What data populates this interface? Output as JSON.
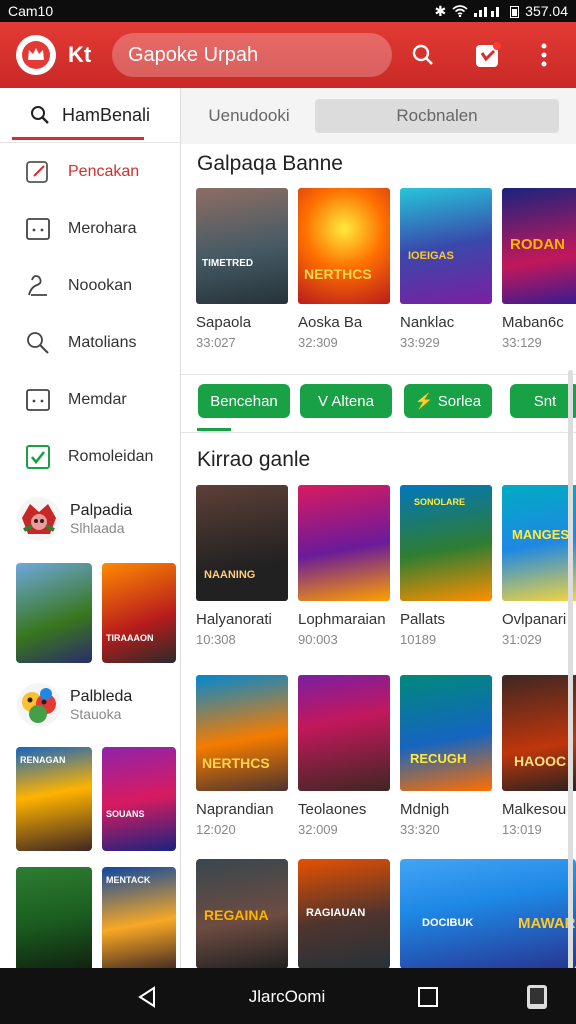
{
  "status_bar": {
    "left": "Cam10",
    "time": "357.04"
  },
  "app_bar": {
    "brand": "Kt",
    "search_placeholder": "Gapoke Urpah",
    "notification_badge": "1",
    "accent": "#d32f2f"
  },
  "sidebar": {
    "header": "HamBenali",
    "items": [
      {
        "label": "Pencakan",
        "icon": "edit-icon",
        "active": true
      },
      {
        "label": "Merohara",
        "icon": "face-icon"
      },
      {
        "label": "Noookan",
        "icon": "person-icon"
      },
      {
        "label": "Matolians",
        "icon": "search-icon"
      },
      {
        "label": "Memdar",
        "icon": "face-icon"
      },
      {
        "label": "Romoleidan",
        "icon": "checkbox-icon"
      }
    ],
    "promos": [
      {
        "title": "Palpadia",
        "subtitle": "Slhlaada"
      },
      {
        "title": "Palbleda",
        "subtitle": "Stauoka"
      }
    ]
  },
  "tabs": [
    {
      "label": "Uenudooki"
    },
    {
      "label": "Rocbnalen"
    }
  ],
  "sections": [
    {
      "title": "Galpaqa Banne",
      "cards": [
        {
          "name": "Sapaola",
          "meta": "33:027"
        },
        {
          "name": "Aoska Ba",
          "meta": "32:309"
        },
        {
          "name": "Nanklac",
          "meta": "33:929"
        },
        {
          "name": "Maban6c",
          "meta": "33:129"
        }
      ]
    },
    {
      "title": "Kirrao ganle",
      "cards": [
        {
          "name": "Halyanorati",
          "meta": "10:308"
        },
        {
          "name": "Lophmaraian",
          "meta": "90:003"
        },
        {
          "name": "Pallats",
          "meta": "10189"
        },
        {
          "name": "Ovlpanari",
          "meta": "31:029"
        },
        {
          "name": "Naprandian",
          "meta": "12:020"
        },
        {
          "name": "Teolaones",
          "meta": "32:009"
        },
        {
          "name": "Mdnigh",
          "meta": "33:320"
        },
        {
          "name": "Malkesou",
          "meta": "13:019"
        }
      ]
    }
  ],
  "chips": [
    {
      "label": "Bencehan"
    },
    {
      "label": "V Altena"
    },
    {
      "label": "⚡ Sorlea"
    },
    {
      "label": "Snt"
    }
  ],
  "cover_texts": [
    "TIMETRED",
    "NERTHCS",
    "IOEIGAS",
    "RODAN",
    "NAANING",
    "",
    "SONOLARE",
    "MANGES",
    "NERTHCS",
    "",
    "RECUGH",
    "HAOOC",
    "REGAINA",
    "RAGIAUAN",
    "DOCIBUK",
    "MAWAR"
  ],
  "side_cover_texts": [
    "",
    "TIRAAAON",
    "RENAGAN",
    "SOUANS",
    "",
    "MENTACK"
  ],
  "bottom_nav": {
    "home_label": "JlarcOomi"
  }
}
